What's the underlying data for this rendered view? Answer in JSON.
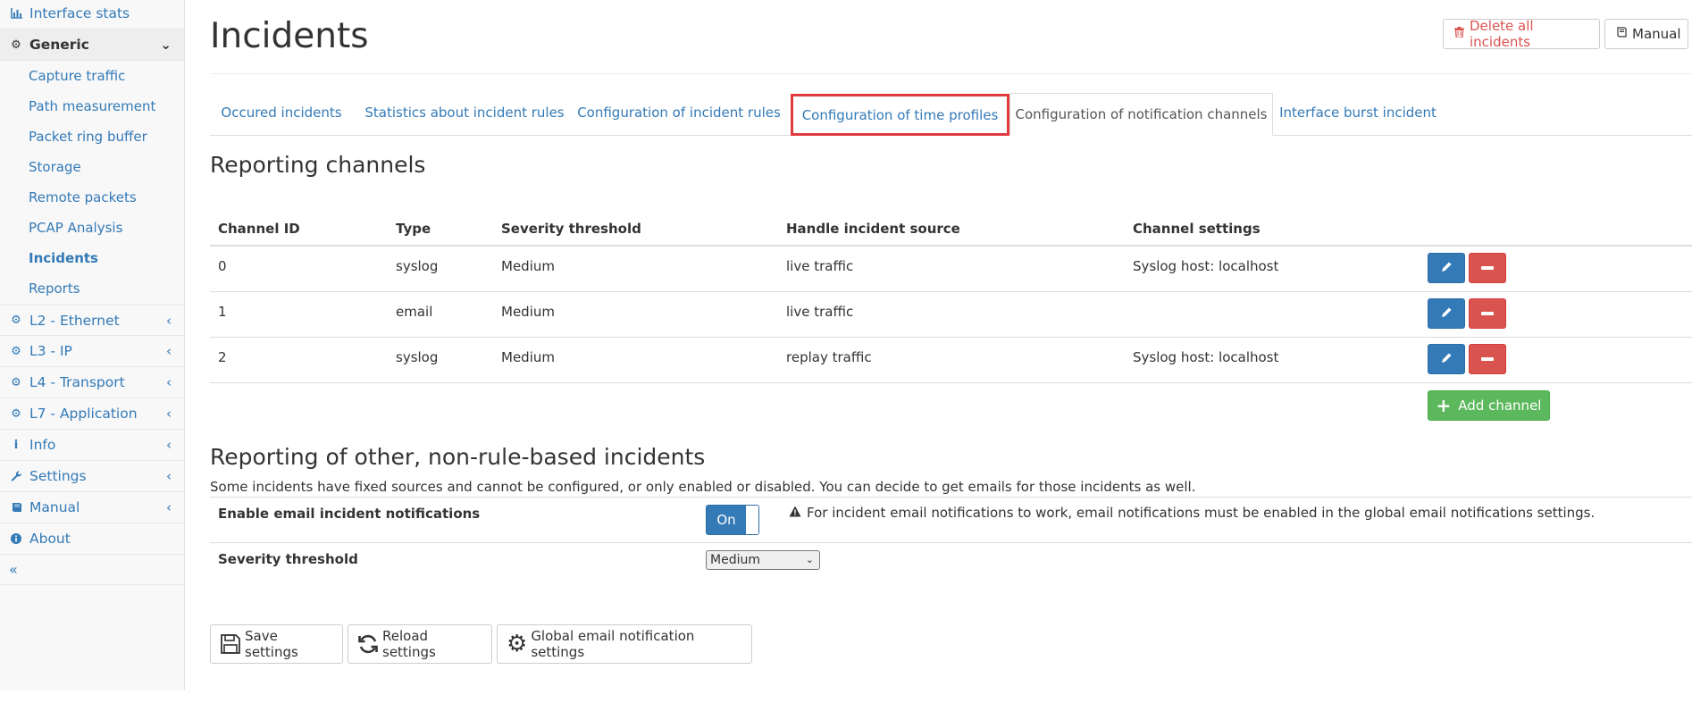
{
  "sidebar": {
    "top_item": {
      "label": "Interface stats",
      "icon": "bar-chart-icon"
    },
    "generic": {
      "label": "Generic",
      "icon": "gear-icon"
    },
    "sub_items": [
      {
        "label": "Capture traffic"
      },
      {
        "label": "Path measurement"
      },
      {
        "label": "Packet ring buffer"
      },
      {
        "label": "Storage"
      },
      {
        "label": "Remote packets"
      },
      {
        "label": "PCAP Analysis"
      },
      {
        "label": "Incidents",
        "active": true
      },
      {
        "label": "Reports"
      }
    ],
    "sections": [
      {
        "label": "L2 - Ethernet",
        "icon": "gear-icon"
      },
      {
        "label": "L3 - IP",
        "icon": "gear-icon"
      },
      {
        "label": "L4 - Transport",
        "icon": "gear-icon"
      },
      {
        "label": "L7 - Application",
        "icon": "gear-icon"
      },
      {
        "label": "Info",
        "icon": "info-icon"
      },
      {
        "label": "Settings",
        "icon": "wrench-icon"
      },
      {
        "label": "Manual",
        "icon": "book-icon"
      },
      {
        "label": "About",
        "icon": "info-circle-icon"
      }
    ],
    "collapse_label": "«"
  },
  "header": {
    "title": "Incidents",
    "delete_all_label": "Delete all incidents",
    "manual_label": "Manual"
  },
  "tabs": [
    {
      "label": "Occured incidents"
    },
    {
      "label": "Statistics about incident rules"
    },
    {
      "label": "Configuration of incident rules"
    },
    {
      "label": "Configuration of time profiles",
      "highlighted": true
    },
    {
      "label": "Configuration of notification channels",
      "active": true
    },
    {
      "label": "Interface burst incident"
    }
  ],
  "channels": {
    "heading": "Reporting channels",
    "columns": [
      "Channel ID",
      "Type",
      "Severity threshold",
      "Handle incident source",
      "Channel settings"
    ],
    "rows": [
      {
        "id": "0",
        "type": "syslog",
        "severity": "Medium",
        "source": "live traffic",
        "settings": "Syslog host: localhost"
      },
      {
        "id": "1",
        "type": "email",
        "severity": "Medium",
        "source": "live traffic",
        "settings": ""
      },
      {
        "id": "2",
        "type": "syslog",
        "severity": "Medium",
        "source": "replay traffic",
        "settings": "Syslog host: localhost"
      }
    ],
    "add_label": "Add channel"
  },
  "other": {
    "heading": "Reporting of other, non-rule-based incidents",
    "description": "Some incidents have fixed sources and cannot be configured, or only enabled or disabled. You can decide to get emails for those incidents as well.",
    "email_label": "Enable email incident notifications",
    "toggle_label": "On",
    "warning": "For incident email notifications to work, email notifications must be enabled in the global email notifications settings.",
    "severity_label": "Severity threshold",
    "severity_value": "Medium"
  },
  "footer": {
    "save_label": "Save settings",
    "reload_label": "Reload settings",
    "global_label": "Global email notification settings"
  },
  "colors": {
    "link": "#337ab7",
    "danger": "#d9534f",
    "success": "#5cb85c",
    "highlight": "#e0393e"
  }
}
